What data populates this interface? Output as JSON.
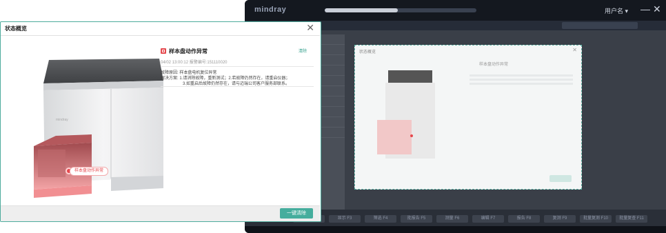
{
  "app": {
    "logo": "mindray",
    "user_label": "用户名 ▾",
    "minimize": "—",
    "close": "✕",
    "progress": 0.48,
    "function_keys": [
      "视图设置 F1",
      "显示 F3",
      "筛选 F4",
      "批报告 F5",
      "测量 F6",
      "编辑 F7",
      "报告 F8",
      "复测 F9",
      "批量复测 F10",
      "批量复查 F11"
    ]
  },
  "inner_dialog": {
    "title": "状态概览"
  },
  "dialog": {
    "title": "状态概览",
    "close_label": "✕",
    "error": {
      "title": "样本盘动作异常",
      "clear_label": "清除",
      "meta": "04/02 13:00:12  报警编号:151110020",
      "cause_label": "故障原因:",
      "cause": "样本盘电机复位异常",
      "solution_label": "解决方案:",
      "solution_1": "1.请消除故障，重新测试；2.若故障仍然存在，请重启仪器；",
      "solution_2": "3.如重启后故障仍然存在，请与迈瑞公司客户服务部联系。"
    },
    "callout": "样本盘动作异常",
    "clear_all_label": "一键清除"
  },
  "colors": {
    "accent": "#45ad9d",
    "error": "#e5484d",
    "app_dark": "#1f2430"
  }
}
